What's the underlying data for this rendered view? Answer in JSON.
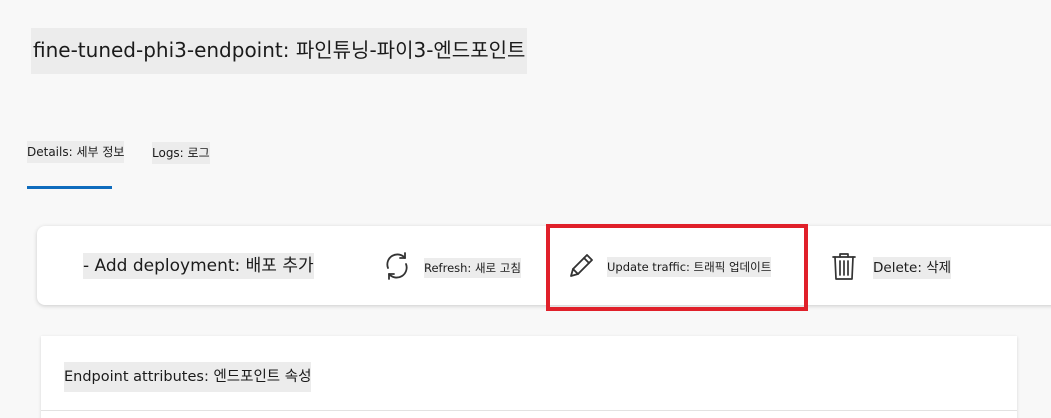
{
  "header": {
    "title": "fine-tuned-phi3-endpoint: 파인튜닝-파이3-엔드포인트"
  },
  "tabs": [
    {
      "label": "Details: 세부 정보",
      "active": true
    },
    {
      "label": "Logs: 로그",
      "active": false
    }
  ],
  "toolbar": {
    "add_label": "- Add deployment: 배포 추가",
    "refresh_label": "Refresh: 새로 고침",
    "update_label": "Update traffic: 트래픽 업데이트",
    "delete_label": "Delete: 삭제",
    "refresh_icon": "refresh-icon",
    "update_icon": "pencil-icon",
    "delete_icon": "trash-icon"
  },
  "attributes": {
    "title": "Endpoint attributes: 엔드포인트 속성"
  },
  "colors": {
    "accent": "#0f6cbd",
    "highlight": "#e0202a",
    "background": "#f8f8f8"
  }
}
